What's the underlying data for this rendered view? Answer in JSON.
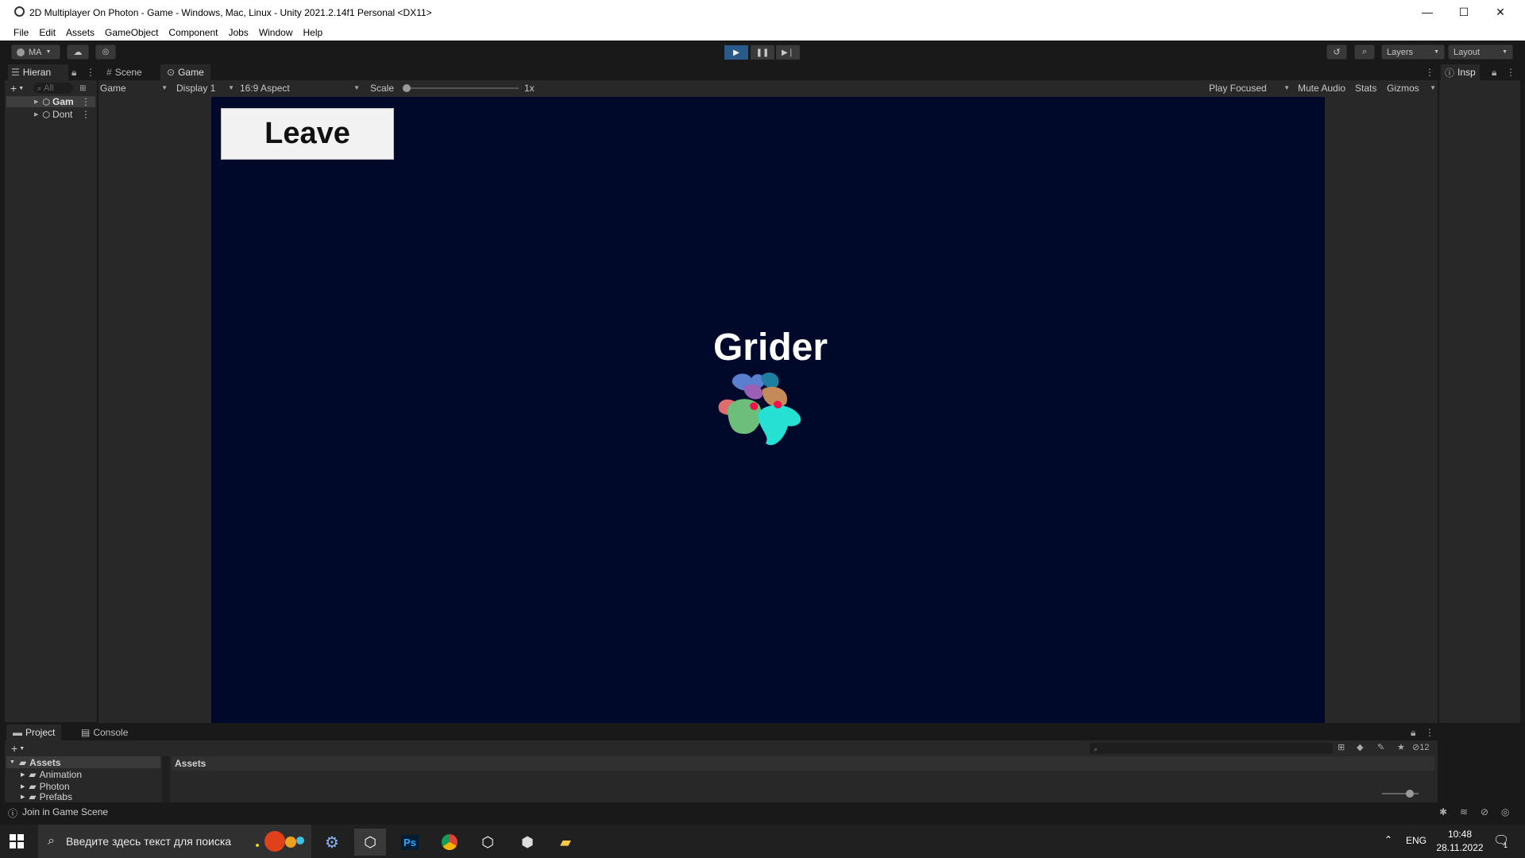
{
  "window": {
    "title": "2D Multiplayer On Photon - Game - Windows, Mac, Linux - Unity 2021.2.14f1 Personal <DX11>",
    "controls": [
      "—",
      "☐",
      "✕"
    ]
  },
  "menu": [
    "File",
    "Edit",
    "Assets",
    "GameObject",
    "Component",
    "Jobs",
    "Window",
    "Help"
  ],
  "toolbar": {
    "account_label": "MA",
    "layers_label": "Layers",
    "layout_label": "Layout"
  },
  "hierarchy": {
    "tab_label": "Hieran",
    "search_placeholder": "All",
    "items": [
      {
        "label": "Gam"
      },
      {
        "label": "Dont"
      }
    ]
  },
  "center_tabs": [
    {
      "label": "Scene",
      "icon": "grid-icon"
    },
    {
      "label": "Game",
      "icon": "gamepad-icon"
    }
  ],
  "game_toolbar": {
    "mode": "Game",
    "display": "Display 1",
    "aspect": "16:9 Aspect",
    "scale_label": "Scale",
    "scale_value": "1x",
    "scale_fraction": 0.0,
    "play_focused": "Play Focused",
    "mute_audio": "Mute Audio",
    "stats": "Stats",
    "gizmos": "Gizmos"
  },
  "game_view": {
    "leave_button": "Leave",
    "game_title": "Grider",
    "background_color": "#01092a"
  },
  "inspector": {
    "tab_label": "Insp"
  },
  "bottom_tabs": [
    {
      "label": "Project",
      "icon": "folder-icon"
    },
    {
      "label": "Console",
      "icon": "console-icon"
    }
  ],
  "project": {
    "tree": [
      {
        "label": "Assets",
        "root": true
      },
      {
        "label": "Animation"
      },
      {
        "label": "Photon"
      },
      {
        "label": "Prefabs"
      }
    ],
    "breadcrumb": "Assets",
    "hidden_count": "12"
  },
  "status": {
    "message": "Join in Game Scene"
  },
  "taskbar": {
    "search_placeholder": "Введите здесь текст для поиска",
    "language": "ENG",
    "time": "10:48",
    "date": "28.11.2022",
    "notification_count": "1"
  }
}
